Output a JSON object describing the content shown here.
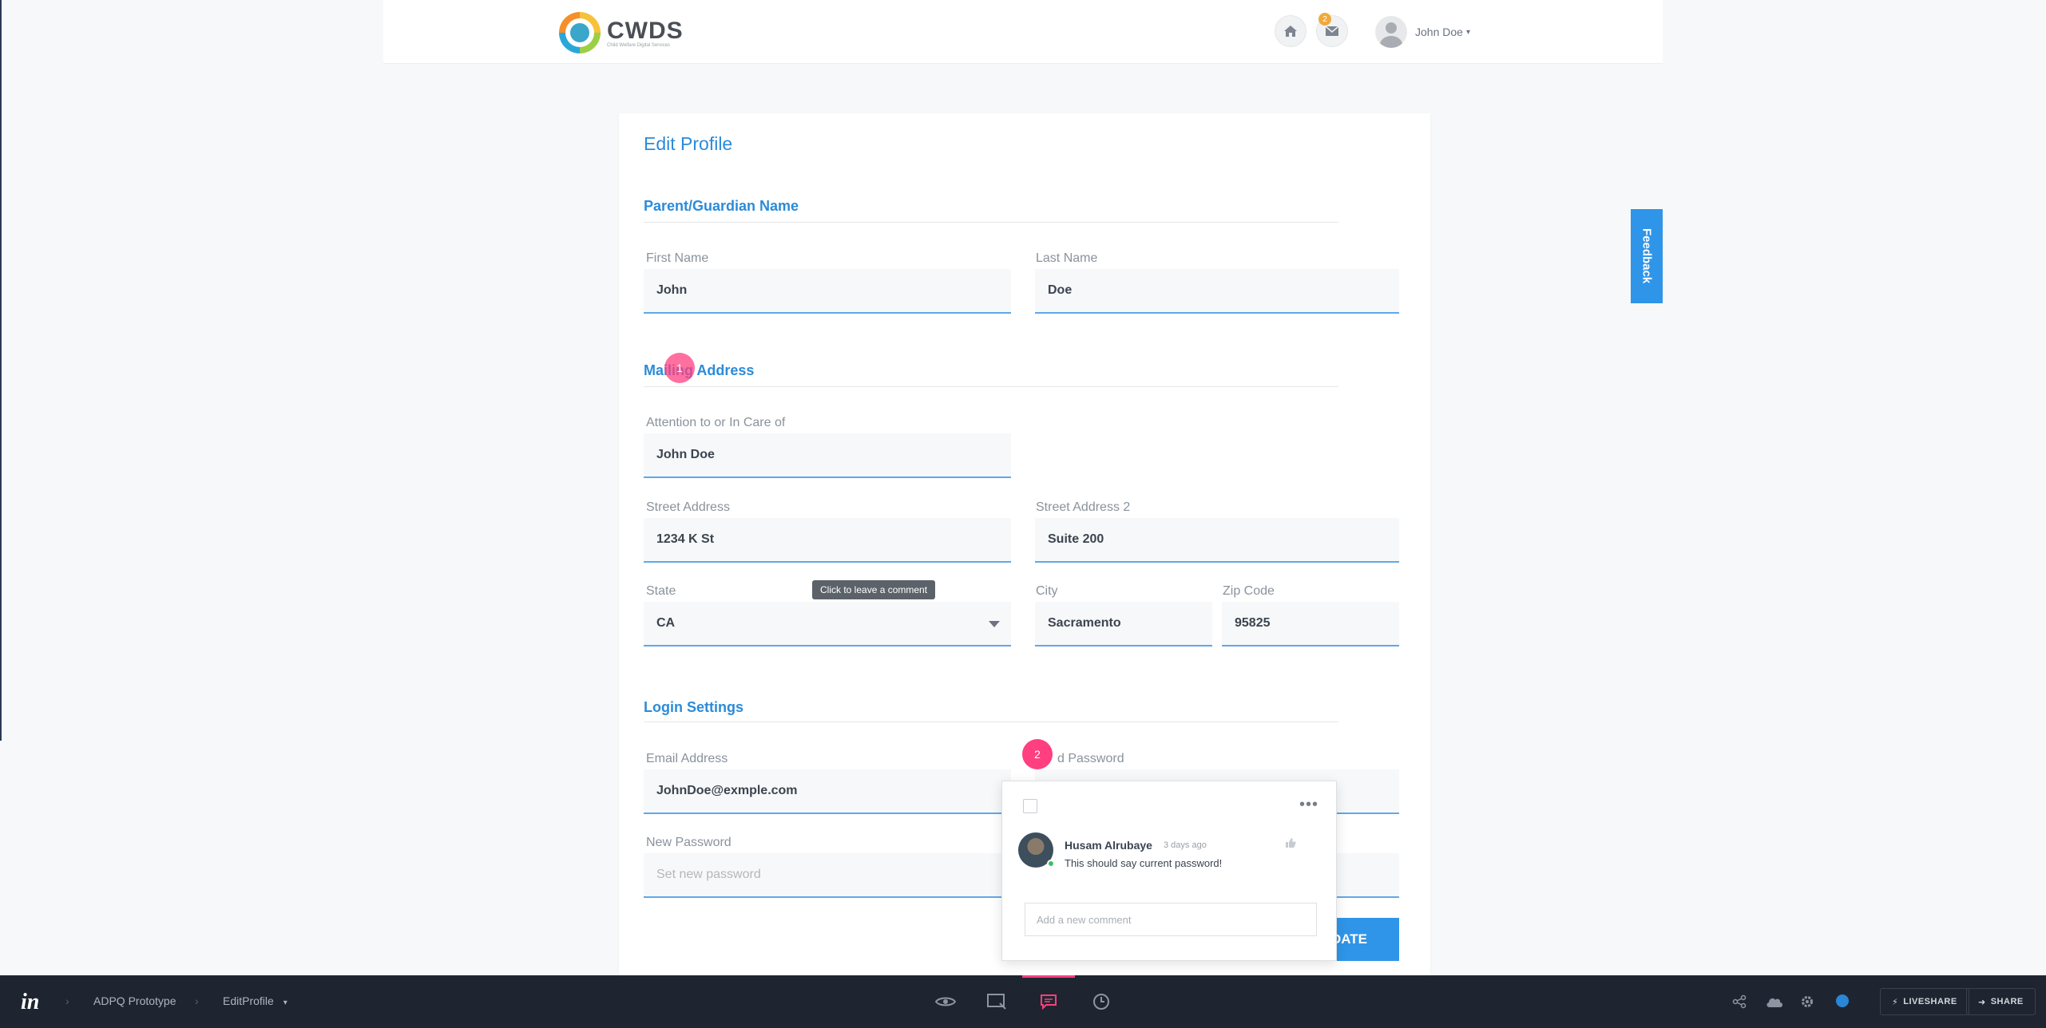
{
  "header": {
    "logo_text": "CWDS",
    "logo_tagline": "Child Welfare Digital Services",
    "notification_count": "2",
    "user_name": "John Doe",
    "user_caret": "▾"
  },
  "page": {
    "title": "Edit Profile",
    "feedback_label": "Feedback",
    "update_label": "DATE",
    "tooltip": "Click to leave a comment"
  },
  "sections": {
    "guardian": "Parent/Guardian Name",
    "mailing": "Mailing Address",
    "login": "Login Settings"
  },
  "fields": {
    "first_name": {
      "label": "First Name",
      "value": "John"
    },
    "last_name": {
      "label": "Last Name",
      "value": "Doe"
    },
    "attention": {
      "label": "Attention to or In Care of",
      "value": "John Doe"
    },
    "street": {
      "label": "Street Address",
      "value": "1234 K St"
    },
    "street2": {
      "label": "Street Address 2",
      "value": "Suite 200"
    },
    "state": {
      "label": "State",
      "value": "CA"
    },
    "city": {
      "label": "City",
      "value": "Sacramento"
    },
    "zip": {
      "label": "Zip Code",
      "value": "95825"
    },
    "email": {
      "label": "Email Address",
      "value": "JohnDoe@exmple.com"
    },
    "current_password": {
      "label": "d Password",
      "value": ""
    },
    "new_password": {
      "label": "New Password",
      "placeholder": "Set new password"
    }
  },
  "pins": {
    "pin1": "1",
    "pin2": "2"
  },
  "comment": {
    "author": "Husam Alrubaye",
    "time": "3 days ago",
    "text": "This should say current password!",
    "more": "•••",
    "input_placeholder": "Add a new comment"
  },
  "toolbar": {
    "logo": "in",
    "crumb1": "ADPQ Prototype",
    "crumb2": "EditProfile",
    "crumb_caret": "▾",
    "sep": "›",
    "liveshare": "LIVESHARE",
    "share": "SHARE"
  },
  "colors": {
    "accent": "#2b8bd9",
    "button": "#2f95e8",
    "pin": "#ff3f7f",
    "toolbar_bg": "#1f2530"
  }
}
